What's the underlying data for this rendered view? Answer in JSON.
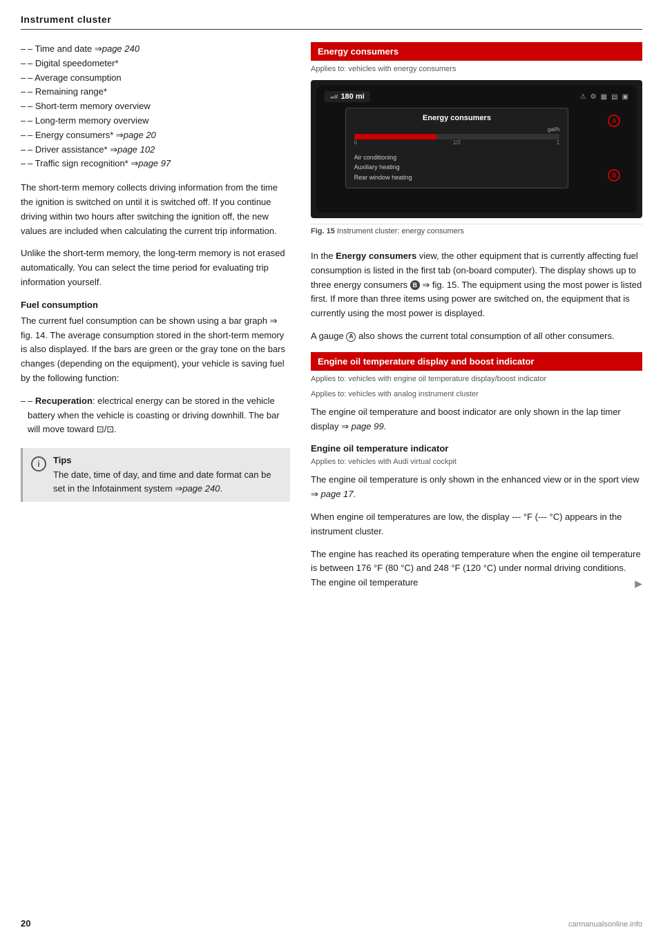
{
  "header": {
    "title": "Instrument cluster"
  },
  "left": {
    "bullet_items": [
      {
        "text": "Time and date ",
        "link": "page 240",
        "italic": true
      },
      {
        "text": "Digital speedometer*"
      },
      {
        "text": "Average consumption"
      },
      {
        "text": "Remaining range*"
      },
      {
        "text": "Short-term memory overview"
      },
      {
        "text": "Long-term memory overview"
      },
      {
        "text": "Energy consumers* ",
        "link": "page 20",
        "italic": true
      },
      {
        "text": "Driver assistance* ",
        "link": "page 102",
        "italic": true
      },
      {
        "text": "Traffic sign recognition* ",
        "link": "page 97",
        "italic": true
      }
    ],
    "para1": "The short-term memory collects driving information from the time the ignition is switched on until it is switched off. If you continue driving within two hours after switching the ignition off, the new values are included when calculating the current trip information.",
    "para2": "Unlike the short-term memory, the long-term memory is not erased automatically. You can select the time period for evaluating trip information yourself.",
    "fuel_heading": "Fuel consumption",
    "fuel_para": "The current fuel consumption can be shown using a bar graph ⇒ fig. 14. The average consumption stored in the short-term memory is also displayed. If the bars are green or the gray tone on the bars changes (depending on the equipment), your vehicle is saving fuel by the following function:",
    "recuperation_label": "Recuperation",
    "recuperation_text": ": electrical energy can be stored in the vehicle battery when the vehicle is coasting or driving downhill. The bar will move toward",
    "recuperation_symbol": "⊡/⊡.",
    "tips_title": "Tips",
    "tips_text": "The date, time of day, and time and date format can be set in the Infotainment system ⇒ page 240."
  },
  "right": {
    "energy_consumers_banner": "Energy consumers",
    "energy_applies": "Applies to: vehicles with energy consumers",
    "cluster_speed": "180 mi",
    "cluster_panel_title": "Energy consumers",
    "cluster_gauge_unit": "gal/h",
    "cluster_scale": [
      "0",
      "1/2",
      "1"
    ],
    "cluster_items": [
      "Air conditioning",
      "Auxiliary heating",
      "Rear window heating"
    ],
    "label_a": "A",
    "label_b": "B",
    "fig_label": "Fig. 15",
    "fig_caption": "Instrument cluster: energy consumers",
    "body1_part1": "In the ",
    "body1_bold": "Energy consumers",
    "body1_part2": " view, the other equipment that is currently affecting fuel consumption is listed in the first tab (on-board computer). The display shows up to three energy consumers",
    "body1_circle_b": "B",
    "body1_part3": "⇒ fig. 15. The equipment using the most power is listed first. If more than three items using power are switched on, the equipment that is currently using the most power is displayed.",
    "body2": "A gauge",
    "body2_circle_a": "A",
    "body2_part2": " also shows the current total consumption of all other consumers.",
    "engine_oil_banner": "Engine oil temperature display and boost indicator",
    "engine_oil_applies": "Applies to: vehicles with engine oil temperature display/boost indicator",
    "engine_oil_applies2": "Applies to: vehicles with analog instrument cluster",
    "engine_oil_para1": "The engine oil temperature and boost indicator are only shown in the lap timer display ⇒ page 99.",
    "engine_oil_indicator_heading": "Engine oil temperature indicator",
    "engine_oil_indicator_applies": "Applies to: vehicles with Audi virtual cockpit",
    "engine_oil_indicator_para1": "The engine oil temperature is only shown in the enhanced view or in the sport view ⇒ page 17.",
    "engine_oil_indicator_para2": "When engine oil temperatures are low, the display --- °F (--- °C) appears in the instrument cluster.",
    "engine_oil_indicator_para3": "The engine has reached its operating temperature when the engine oil temperature is between 176 °F (80 °C) and 248 °F (120 °C) under normal driving conditions. The engine oil temperature",
    "arrow": "▶"
  },
  "footer": {
    "page_number": "20",
    "watermark": "carmanualsonline.info"
  }
}
